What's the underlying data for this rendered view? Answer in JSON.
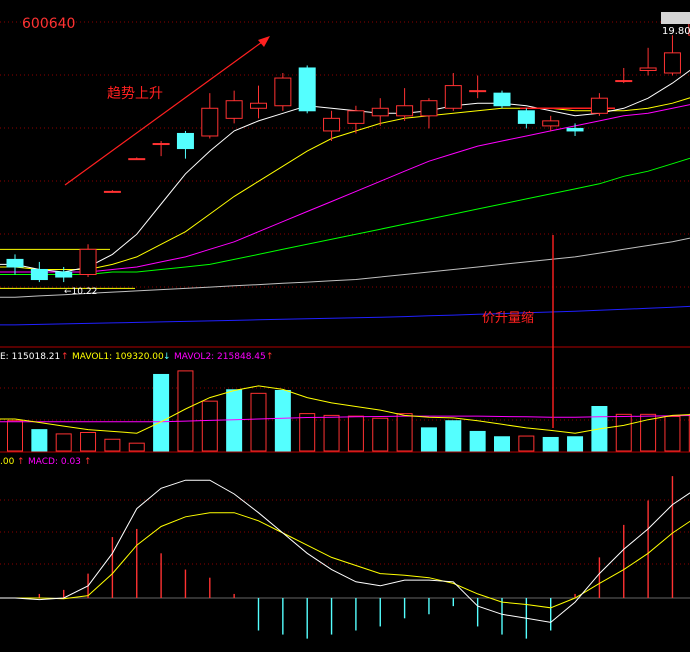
{
  "stock_code": "600640",
  "price_label": "19.80",
  "low_price_label": "←10.22",
  "annotations": {
    "trend": "趋势上升",
    "price_up_volume_down": "价升量缩"
  },
  "volume_header": {
    "vol": "E: 115018.21",
    "mavol1": "MAVOL1: 109320.00",
    "mavol2": "MAVOL2: 215848.45"
  },
  "macd_header": {
    "left": ".00",
    "macd": "MACD: 0.03"
  },
  "colors": {
    "up": "#ff3232",
    "down": "#54ffff",
    "ma5": "#ffffff",
    "ma10": "#ffff00",
    "ma20": "#ff00ff",
    "ma30": "#00ff00",
    "ma60": "#c0c0c0",
    "ma120": "#2020ff",
    "grid": "#8b0000"
  },
  "chart_data": [
    {
      "type": "candlestick",
      "title": "600640",
      "candles": [
        {
          "o": 13.2,
          "h": 13.4,
          "l": 12.6,
          "c": 12.9
        },
        {
          "o": 12.8,
          "h": 13.1,
          "l": 12.3,
          "c": 12.4
        },
        {
          "o": 12.7,
          "h": 12.9,
          "l": 12.3,
          "c": 12.5
        },
        {
          "o": 12.6,
          "h": 13.8,
          "l": 12.5,
          "c": 13.6
        },
        {
          "o": 15.9,
          "h": 15.95,
          "l": 15.85,
          "c": 15.9
        },
        {
          "o": 17.2,
          "h": 17.25,
          "l": 17.15,
          "c": 17.2
        },
        {
          "o": 17.8,
          "h": 17.9,
          "l": 17.3,
          "c": 17.8
        },
        {
          "o": 18.2,
          "h": 18.3,
          "l": 17.2,
          "c": 17.6
        },
        {
          "o": 18.1,
          "h": 19.8,
          "l": 18.0,
          "c": 19.2
        },
        {
          "o": 18.8,
          "h": 19.9,
          "l": 18.6,
          "c": 19.5
        },
        {
          "o": 19.2,
          "h": 20.1,
          "l": 18.8,
          "c": 19.4
        },
        {
          "o": 19.3,
          "h": 20.6,
          "l": 19.1,
          "c": 20.4
        },
        {
          "o": 20.8,
          "h": 20.9,
          "l": 19.0,
          "c": 19.1
        },
        {
          "o": 18.3,
          "h": 19.1,
          "l": 17.9,
          "c": 18.8
        },
        {
          "o": 18.6,
          "h": 19.3,
          "l": 18.2,
          "c": 19.1
        },
        {
          "o": 18.9,
          "h": 19.6,
          "l": 18.5,
          "c": 19.2
        },
        {
          "o": 18.9,
          "h": 20.0,
          "l": 18.7,
          "c": 19.3
        },
        {
          "o": 18.9,
          "h": 19.6,
          "l": 18.4,
          "c": 19.5
        },
        {
          "o": 19.2,
          "h": 20.6,
          "l": 19.1,
          "c": 20.1
        },
        {
          "o": 19.9,
          "h": 20.5,
          "l": 19.6,
          "c": 19.9
        },
        {
          "o": 19.8,
          "h": 19.9,
          "l": 19.2,
          "c": 19.3
        },
        {
          "o": 19.1,
          "h": 19.2,
          "l": 18.4,
          "c": 18.6
        },
        {
          "o": 18.5,
          "h": 18.9,
          "l": 18.3,
          "c": 18.7
        },
        {
          "o": 18.4,
          "h": 18.6,
          "l": 18.1,
          "c": 18.3
        },
        {
          "o": 19.0,
          "h": 19.8,
          "l": 18.9,
          "c": 19.6
        },
        {
          "o": 20.3,
          "h": 20.8,
          "l": 20.2,
          "c": 20.3
        },
        {
          "o": 20.7,
          "h": 21.6,
          "l": 20.5,
          "c": 20.8
        },
        {
          "o": 20.6,
          "h": 22.1,
          "l": 20.5,
          "c": 21.4
        },
        {
          "o": 22.1,
          "h": 23.2,
          "l": 21.3,
          "c": 22.7
        }
      ],
      "ma5": [
        13.0,
        12.8,
        12.7,
        12.9,
        13.4,
        14.2,
        15.4,
        16.6,
        17.5,
        18.3,
        18.7,
        19.0,
        19.3,
        19.2,
        19.1,
        19.0,
        19.0,
        19.1,
        19.3,
        19.4,
        19.4,
        19.3,
        19.1,
        18.9,
        19.0,
        19.2,
        19.6,
        20.2,
        20.9
      ],
      "ma10": [
        12.9,
        12.8,
        12.8,
        12.8,
        13.0,
        13.3,
        13.8,
        14.3,
        15.0,
        15.7,
        16.3,
        16.9,
        17.5,
        18.0,
        18.3,
        18.6,
        18.8,
        18.9,
        19.0,
        19.1,
        19.2,
        19.2,
        19.2,
        19.1,
        19.1,
        19.1,
        19.2,
        19.4,
        19.7
      ],
      "ma20": [
        12.7,
        12.7,
        12.7,
        12.7,
        12.8,
        12.9,
        13.1,
        13.3,
        13.6,
        13.9,
        14.3,
        14.7,
        15.1,
        15.5,
        15.9,
        16.3,
        16.7,
        17.1,
        17.4,
        17.7,
        17.9,
        18.1,
        18.3,
        18.5,
        18.7,
        18.9,
        19.0,
        19.2,
        19.4
      ],
      "ma30": [
        12.6,
        12.6,
        12.6,
        12.6,
        12.7,
        12.7,
        12.8,
        12.9,
        13.0,
        13.2,
        13.4,
        13.6,
        13.8,
        14.0,
        14.2,
        14.4,
        14.6,
        14.8,
        15.0,
        15.2,
        15.4,
        15.6,
        15.8,
        16.0,
        16.2,
        16.5,
        16.7,
        17.0,
        17.3
      ],
      "ma60": [
        11.7,
        11.75,
        11.8,
        11.85,
        11.9,
        11.95,
        12.0,
        12.05,
        12.1,
        12.15,
        12.2,
        12.25,
        12.3,
        12.35,
        12.4,
        12.5,
        12.6,
        12.7,
        12.8,
        12.9,
        13.0,
        13.1,
        13.2,
        13.3,
        13.45,
        13.6,
        13.75,
        13.9,
        14.1
      ],
      "ma120": [
        10.6,
        10.62,
        10.64,
        10.66,
        10.68,
        10.7,
        10.72,
        10.74,
        10.76,
        10.78,
        10.8,
        10.82,
        10.84,
        10.86,
        10.88,
        10.9,
        10.93,
        10.96,
        10.99,
        11.02,
        11.05,
        11.08,
        11.11,
        11.14,
        11.18,
        11.22,
        11.26,
        11.3,
        11.35
      ],
      "ylim": [
        10.0,
        23.3
      ],
      "labels": {
        "last_price": "19.80",
        "low": "←10.22"
      }
    },
    {
      "type": "bar",
      "title": "VOL",
      "values": [
        85000,
        60000,
        48000,
        52000,
        33000,
        22000,
        215000,
        225000,
        140000,
        172000,
        162000,
        170000,
        105000,
        100000,
        98000,
        92000,
        105000,
        65000,
        85000,
        55000,
        40000,
        42000,
        38000,
        40000,
        125000,
        103000,
        103000,
        97000,
        103000
      ],
      "up": [
        true,
        false,
        true,
        true,
        true,
        true,
        false,
        true,
        true,
        false,
        true,
        false,
        true,
        true,
        true,
        true,
        true,
        false,
        false,
        false,
        false,
        true,
        false,
        false,
        false,
        true,
        true,
        true,
        true
      ],
      "mavol1": [
        90000,
        80000,
        70000,
        60000,
        55000,
        50000,
        82000,
        118000,
        150000,
        170000,
        183000,
        173000,
        150000,
        135000,
        125000,
        115000,
        100000,
        95000,
        93000,
        85000,
        75000,
        65000,
        58000,
        50000,
        62000,
        72000,
        88000,
        100000,
        103000
      ],
      "mavol2": [
        82000,
        82000,
        82000,
        82000,
        82000,
        82000,
        82000,
        84000,
        86000,
        88000,
        90000,
        92000,
        94000,
        95000,
        96000,
        97000,
        98000,
        98000,
        98000,
        98000,
        97000,
        96000,
        95000,
        95000,
        96000,
        97000,
        98000,
        99000,
        100000
      ],
      "ylim": [
        0,
        250000
      ]
    },
    {
      "type": "line",
      "title": "MACD",
      "dif": [
        0.0,
        -0.02,
        0.0,
        0.15,
        0.55,
        1.1,
        1.35,
        1.45,
        1.45,
        1.28,
        1.05,
        0.8,
        0.55,
        0.35,
        0.2,
        0.15,
        0.22,
        0.22,
        0.2,
        -0.1,
        -0.2,
        -0.25,
        -0.3,
        -0.05,
        0.3,
        0.6,
        0.85,
        1.15,
        1.35
      ],
      "dea": [
        0.0,
        0.0,
        -0.01,
        0.03,
        0.3,
        0.65,
        0.88,
        1.0,
        1.05,
        1.05,
        0.95,
        0.8,
        0.65,
        0.5,
        0.4,
        0.3,
        0.28,
        0.25,
        0.18,
        0.05,
        -0.05,
        -0.08,
        -0.12,
        0.0,
        0.18,
        0.35,
        0.55,
        0.8,
        1.0
      ],
      "macd": [
        0.0,
        0.05,
        0.1,
        0.3,
        0.75,
        0.85,
        0.55,
        0.35,
        0.25,
        0.05,
        -0.4,
        -0.45,
        -0.5,
        -0.45,
        -0.4,
        -0.35,
        -0.25,
        -0.2,
        -0.1,
        -0.35,
        -0.45,
        -0.5,
        -0.4,
        0.05,
        0.5,
        0.9,
        1.2,
        1.5,
        1.5
      ],
      "ylim": [
        -0.55,
        1.6
      ]
    }
  ]
}
